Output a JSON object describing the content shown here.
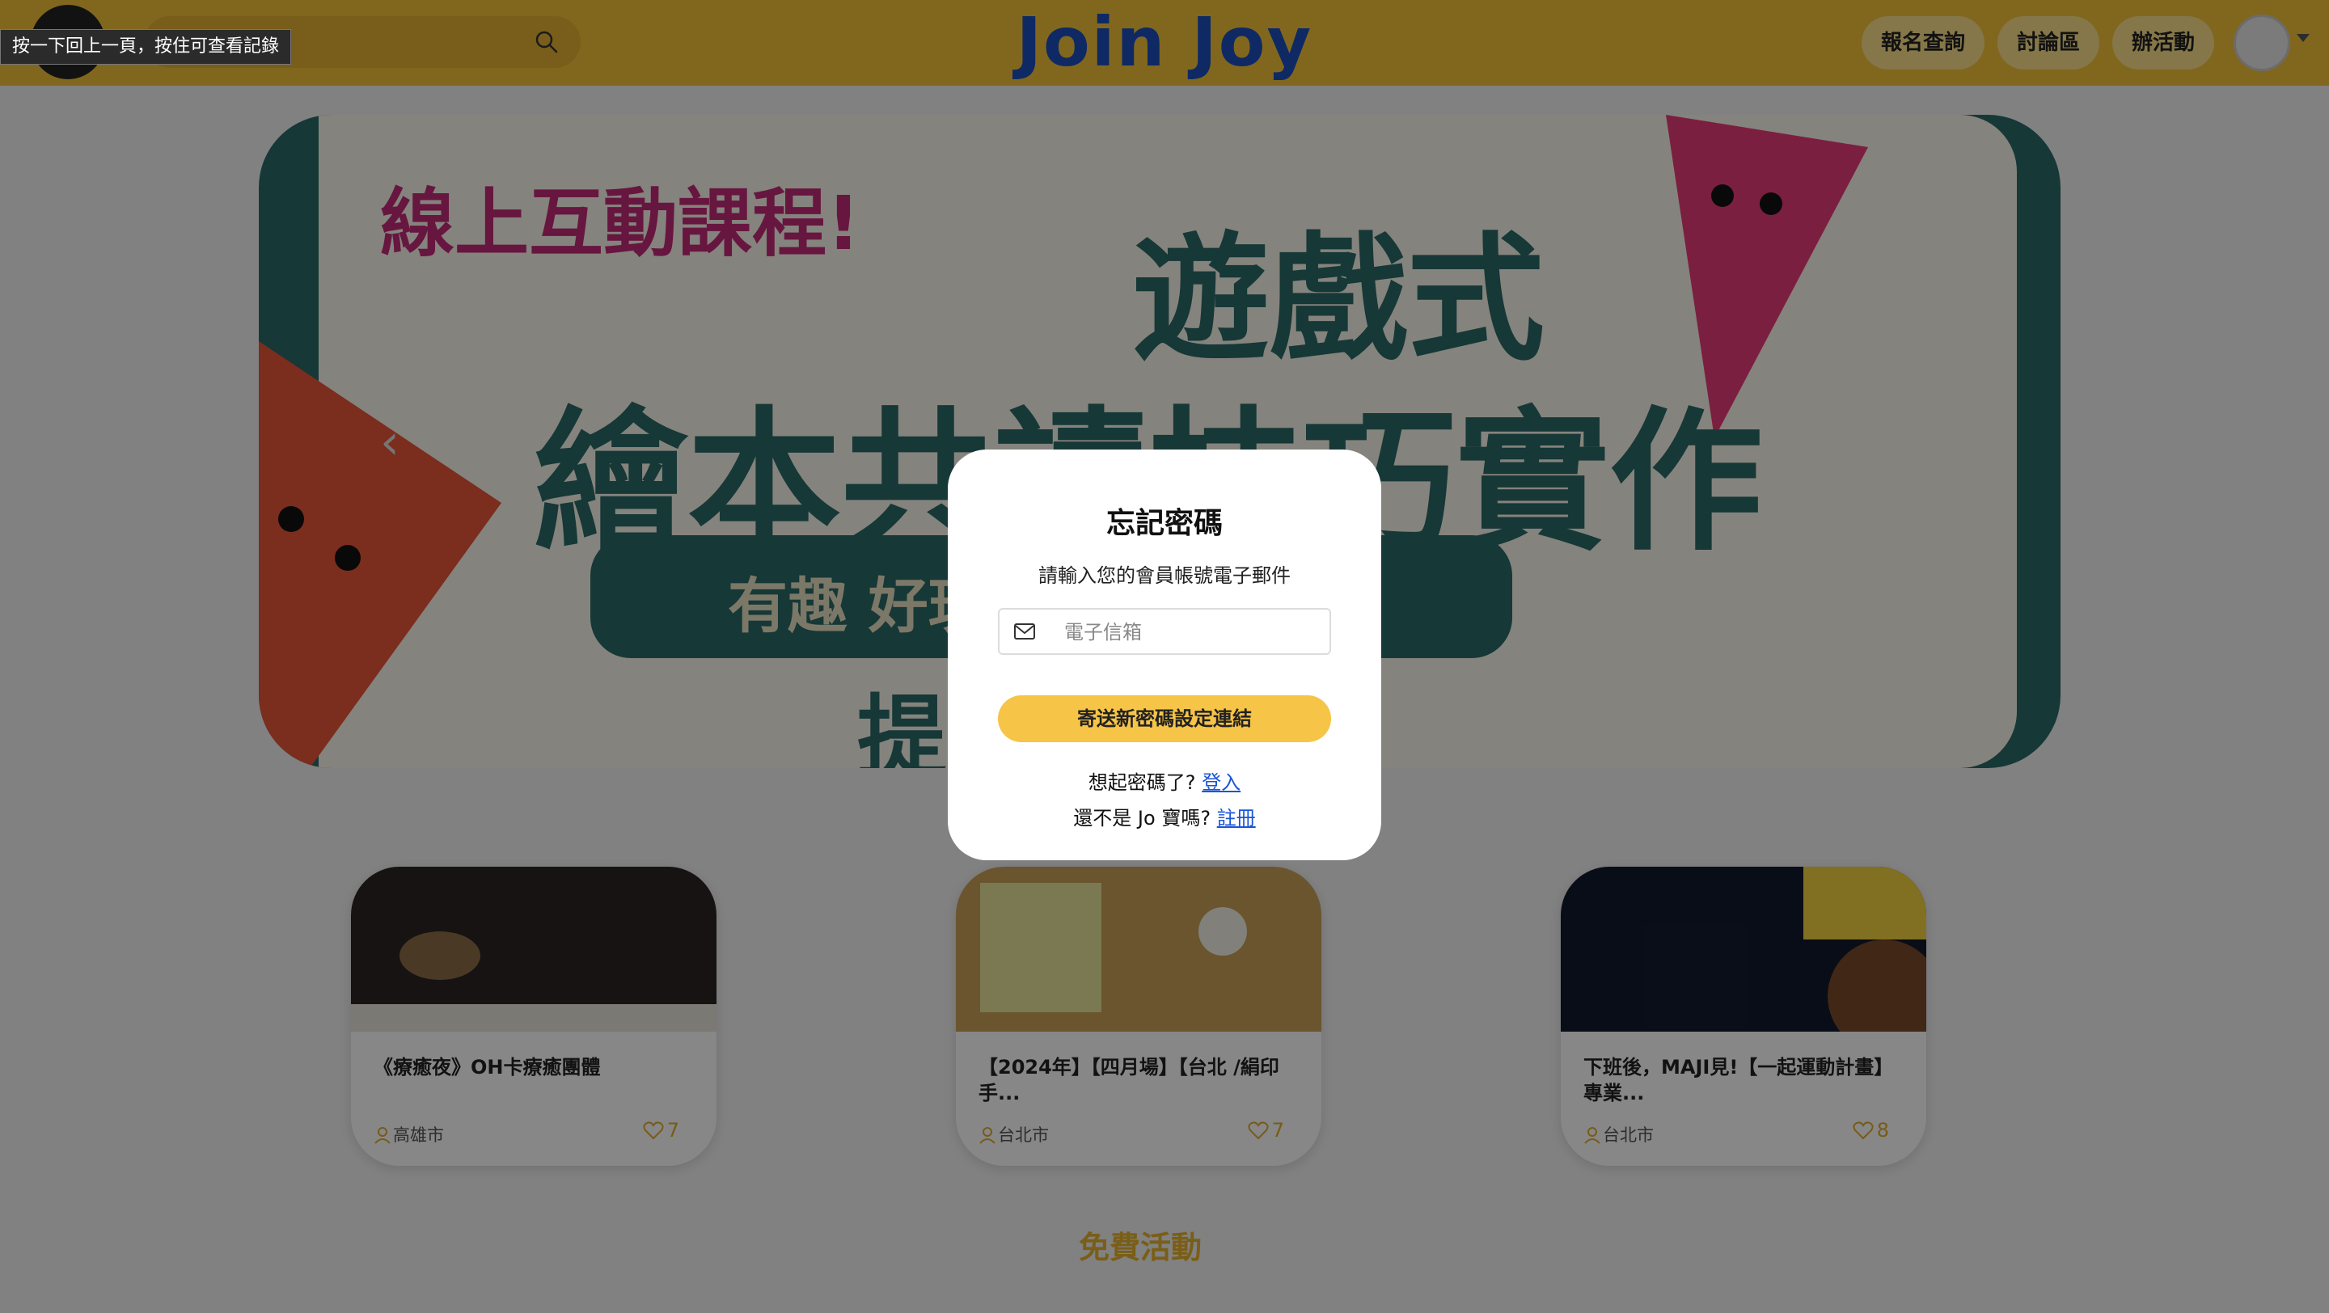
{
  "header": {
    "logo": "Join Joy",
    "tooltip": "按一下回上一頁，按住可查看記錄",
    "nav": [
      "報名查詢",
      "討論區",
      "辦活動"
    ],
    "icons": {
      "search": "search-icon",
      "avatar": "avatar-icon",
      "caret": "chevron-down-icon"
    }
  },
  "banner": {
    "line1": "線上互動課程!",
    "line2": "遊戲式",
    "line3": "繪本共讀技巧實作",
    "pill": "有趣 好玩",
    "line4": "提升 向教養"
  },
  "cards": [
    {
      "title": "《療癒夜》OH卡療癒團體",
      "location": "高雄市",
      "likes": "7"
    },
    {
      "title": "【2024年】【四月場】【台北 /絹印手...",
      "location": "台北市",
      "likes": "7"
    },
    {
      "title": "下班後，MAJI見!【一起運動計畫】專業...",
      "location": "台北市",
      "likes": "8"
    }
  ],
  "section_title": "免費活動",
  "modal": {
    "title": "忘記密碼",
    "subtitle": "請輸入您的會員帳號電子郵件",
    "email_placeholder": "電子信箱",
    "send_button": "寄送新密碼設定連結",
    "remember_text": "想起密碼了? ",
    "login_link": "登入",
    "not_member_text": "還不是 Jo 寶嗎? ",
    "register_link": "註冊"
  },
  "colors": {
    "brand_yellow": "#f4c23a",
    "logo_blue": "#1e4fbe",
    "button_yellow": "#f6c447",
    "link_blue": "#1a55d6"
  }
}
